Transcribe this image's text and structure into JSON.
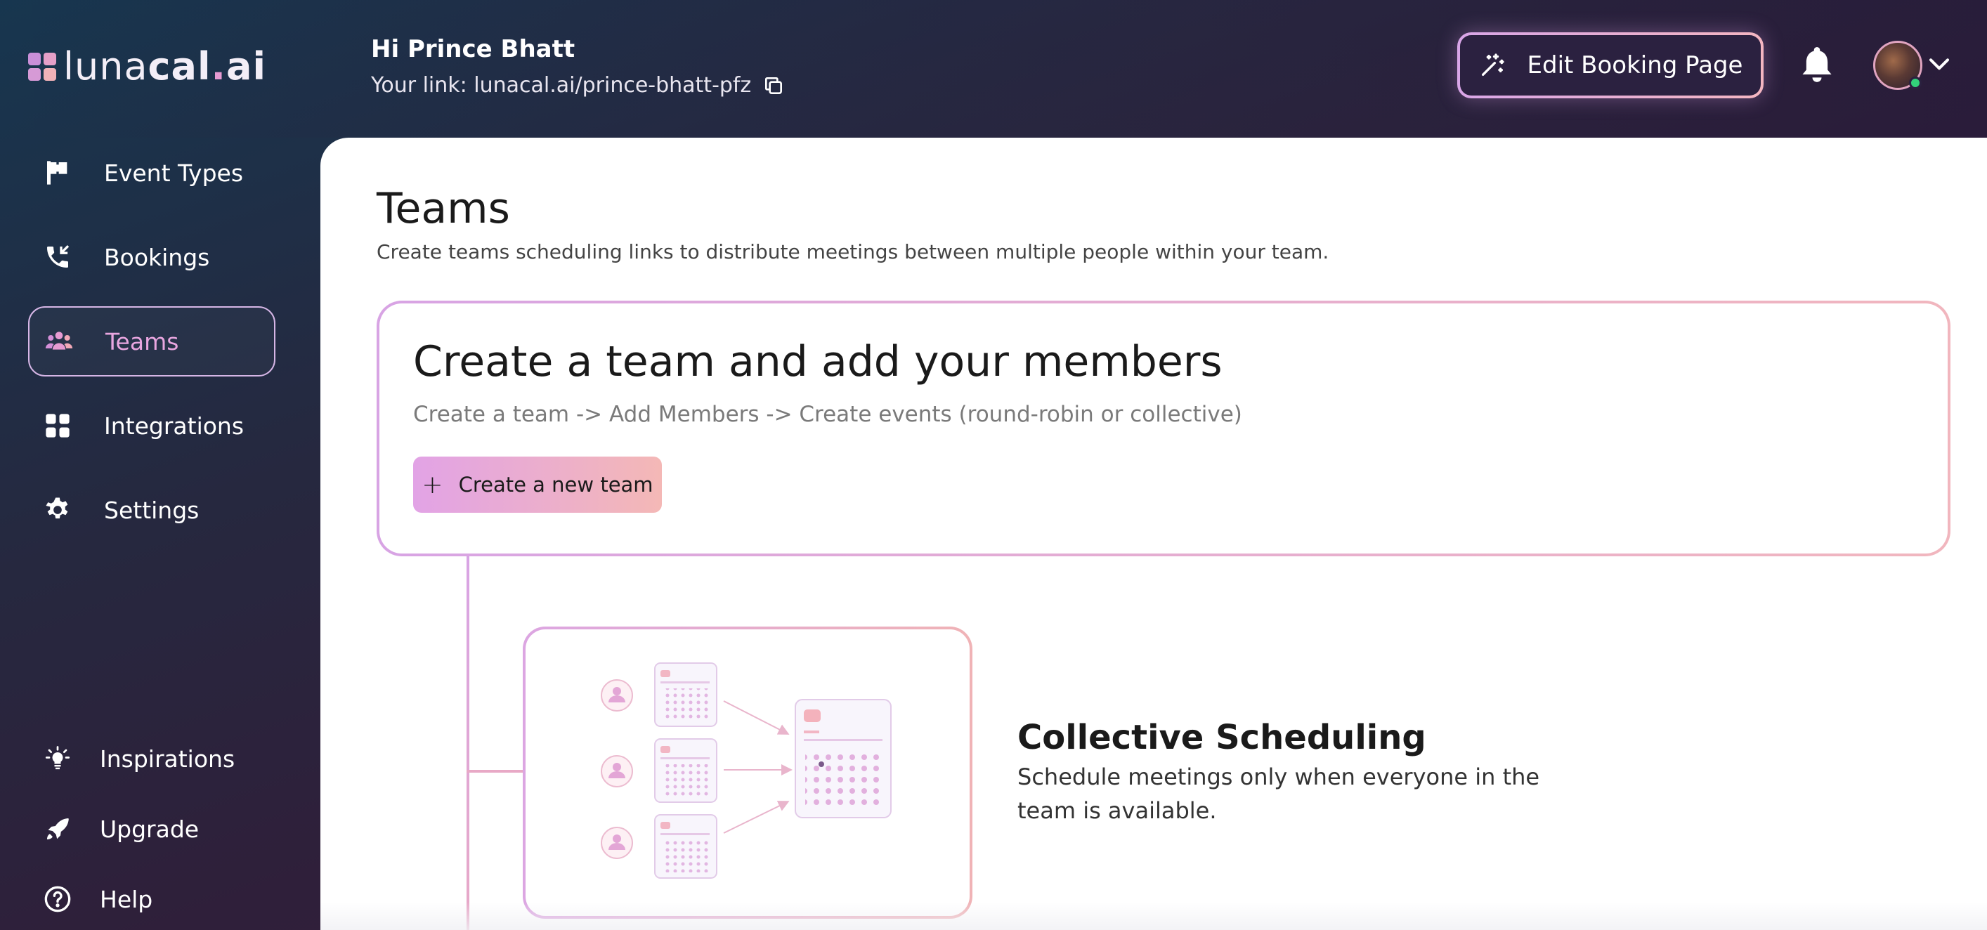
{
  "brand": {
    "logo_part1": "luna",
    "logo_part2": "cal",
    "logo_dot": ".",
    "logo_part3": "ai",
    "colors": {
      "accent_pink": "#e9a6e0",
      "gradient_start": "#d8a4e4",
      "gradient_end": "#f1b6be"
    }
  },
  "header": {
    "greeting": "Hi Prince Bhatt",
    "link_text": "Your link: lunacal.ai/prince-bhatt-pfz",
    "edit_button_label": "Edit Booking Page"
  },
  "sidebar": {
    "items": [
      {
        "label": "Event Types",
        "icon": "flag-icon"
      },
      {
        "label": "Bookings",
        "icon": "phone-incoming-icon"
      },
      {
        "label": "Teams",
        "icon": "team-icon",
        "active": true
      },
      {
        "label": "Integrations",
        "icon": "grid-icon"
      },
      {
        "label": "Settings",
        "icon": "gear-icon"
      }
    ],
    "bottom_items": [
      {
        "label": "Inspirations",
        "icon": "lightbulb-icon"
      },
      {
        "label": "Upgrade",
        "icon": "rocket-icon"
      },
      {
        "label": "Help",
        "icon": "help-icon"
      }
    ]
  },
  "main": {
    "title": "Teams",
    "description": "Create teams scheduling links to distribute meetings between multiple people within your team.",
    "create_card": {
      "title": "Create a team and add your members",
      "steps": "Create a team -> Add Members -> Create events (round-robin or collective)",
      "button_label": "Create a new team"
    },
    "collective": {
      "title": "Collective Scheduling",
      "description": "Schedule meetings only when everyone in the team is available."
    }
  }
}
